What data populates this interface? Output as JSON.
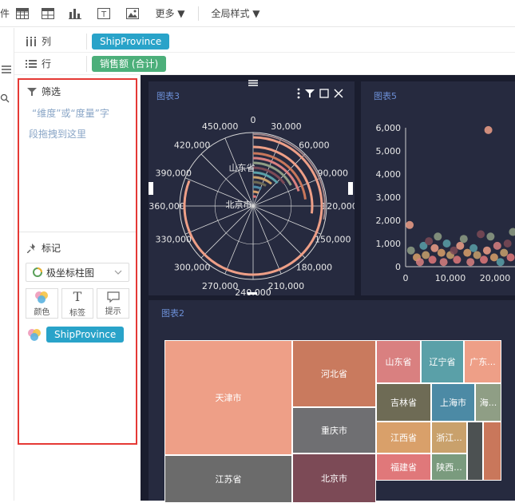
{
  "toolbar": {
    "partial_label": "件",
    "more_label": "更多 ▼",
    "global_style_label": "全局样式 ▼"
  },
  "fields": {
    "columns_label": "列",
    "columns_value": "ShipProvince",
    "rows_label": "行",
    "rows_value": "销售额 (合计)"
  },
  "filter": {
    "title": "筛选",
    "hint_line1": "“维度”或“度量”字",
    "hint_line2": "段拖拽到这里"
  },
  "marks": {
    "title": "标记",
    "chart_type": "极坐标柱图",
    "color_label": "颜色",
    "label_label": "标签",
    "tooltip_label": "提示",
    "field_value": "ShipProvince"
  },
  "colors": {
    "accent": "#29a3c9",
    "green": "#4caf7a",
    "salmon": "#f0a38a",
    "dark_bg": "#1a1d2e",
    "card_bg": "#262a3f",
    "red_border": "#e53935"
  },
  "chart3": {
    "title": "图表3",
    "angle_ticks": [
      "0",
      "30,000",
      "60,000",
      "90,000",
      "120,000",
      "150,000",
      "180,000",
      "210,000",
      "240,000",
      "270,000",
      "300,000",
      "330,000",
      "360,000",
      "390,000",
      "420,000",
      "450,000"
    ],
    "category_labels": [
      "山东省",
      "北京市"
    ]
  },
  "chart5": {
    "title": "图表5",
    "y_ticks": [
      "6,000",
      "5,000",
      "4,000",
      "3,000",
      "2,000",
      "1,000",
      "0"
    ],
    "x_ticks": [
      "0",
      "10,000",
      "20,000"
    ]
  },
  "chart2": {
    "title": "图表2"
  },
  "chart_data": [
    {
      "type": "bar",
      "subtype": "polar",
      "title": "",
      "categories": [
        "山东省",
        "北京市"
      ],
      "angle_axis_range": [
        0,
        480000
      ]
    },
    {
      "type": "scatter",
      "title": "",
      "ylim": [
        0,
        6000
      ],
      "xlim": [
        0,
        25000
      ],
      "points": [
        [
          900,
          1800
        ],
        [
          1200,
          700
        ],
        [
          2500,
          400
        ],
        [
          3200,
          200
        ],
        [
          4000,
          900
        ],
        [
          4500,
          500
        ],
        [
          5200,
          1100
        ],
        [
          6000,
          300
        ],
        [
          6500,
          800
        ],
        [
          7200,
          1300
        ],
        [
          8000,
          600
        ],
        [
          8500,
          200
        ],
        [
          9200,
          1000
        ],
        [
          10000,
          500
        ],
        [
          10800,
          700
        ],
        [
          11500,
          300
        ],
        [
          12200,
          900
        ],
        [
          13000,
          1200
        ],
        [
          13800,
          600
        ],
        [
          14500,
          200
        ],
        [
          15200,
          800
        ],
        [
          16000,
          500
        ],
        [
          16800,
          1400
        ],
        [
          17500,
          300
        ],
        [
          18200,
          700
        ],
        [
          19000,
          1300
        ],
        [
          19800,
          400
        ],
        [
          20500,
          900
        ],
        [
          21200,
          200
        ],
        [
          22000,
          600
        ],
        [
          22800,
          1000
        ],
        [
          23500,
          400
        ],
        [
          18500,
          5900
        ],
        [
          24000,
          1500
        ]
      ]
    },
    {
      "type": "treemap",
      "title": "",
      "cells": [
        {
          "name": "天津市",
          "color": "#ee9f87"
        },
        {
          "name": "江苏省",
          "color": "#6b6b6b"
        },
        {
          "name": "河北省",
          "color": "#c97a5e"
        },
        {
          "name": "重庆市",
          "color": "#6f6f72"
        },
        {
          "name": "北京市",
          "color": "#7c4a56"
        },
        {
          "name": "山东省",
          "color": "#d98080"
        },
        {
          "name": "辽宁省",
          "color": "#5aa0a8"
        },
        {
          "name": "广东...",
          "color": "#ee9f87"
        },
        {
          "name": "吉林省",
          "color": "#6e6b55"
        },
        {
          "name": "上海市",
          "color": "#4c8aa5"
        },
        {
          "name": "海...",
          "color": "#8f9e85"
        },
        {
          "name": "江西省",
          "color": "#d9a06a"
        },
        {
          "name": "浙江...",
          "color": "#c9a16c"
        },
        {
          "name": "福建省",
          "color": "#e0787a"
        },
        {
          "name": "陕西...",
          "color": "#7a9b7e"
        },
        {
          "name": "",
          "color": "#4c5152"
        },
        {
          "name": "",
          "color": "#c9775b"
        }
      ]
    }
  ]
}
